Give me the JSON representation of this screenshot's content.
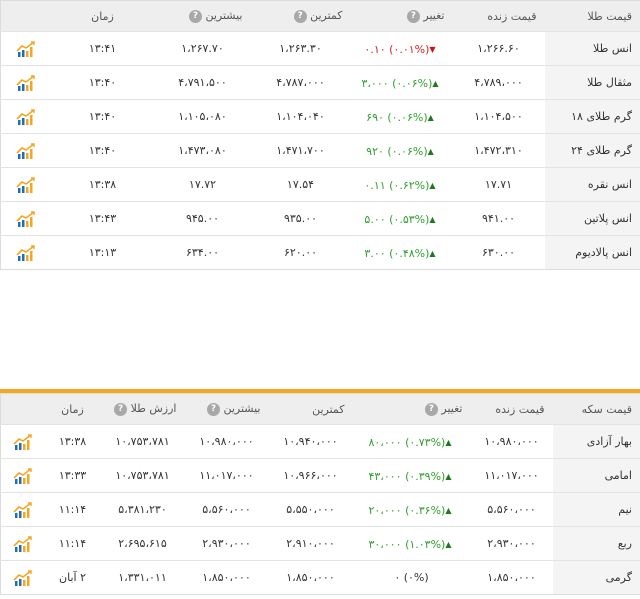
{
  "gold": {
    "headers": {
      "name": "قیمت طلا",
      "live": "قیمت زنده",
      "change": "تغییر",
      "low": "کمترین",
      "high": "بیشترین",
      "time": "زمان"
    },
    "rows": [
      {
        "name": "انس طلا",
        "live": "۱،۲۶۶.۶۰",
        "change_val": "۰.۱۰",
        "change_pct": "(۰.۰۱%)",
        "dir": "down",
        "low": "۱،۲۶۳.۳۰",
        "high": "۱،۲۶۷.۷۰",
        "time": "۱۳:۴۱"
      },
      {
        "name": "مثقال طلا",
        "live": "۴،۷۸۹،۰۰۰",
        "change_val": "۳،۰۰۰",
        "change_pct": "(۰.۰۶%)",
        "dir": "up",
        "low": "۴،۷۸۷،۰۰۰",
        "high": "۴،۷۹۱،۵۰۰",
        "time": "۱۳:۴۰"
      },
      {
        "name": "گرم طلای ۱۸",
        "live": "۱،۱۰۴،۵۰۰",
        "change_val": "۶۹۰",
        "change_pct": "(۰.۰۶%)",
        "dir": "up",
        "low": "۱،۱۰۴،۰۴۰",
        "high": "۱،۱۰۵،۰۸۰",
        "time": "۱۳:۴۰"
      },
      {
        "name": "گرم طلای ۲۴",
        "live": "۱،۴۷۲،۳۱۰",
        "change_val": "۹۲۰",
        "change_pct": "(۰.۰۶%)",
        "dir": "up",
        "low": "۱،۴۷۱،۷۰۰",
        "high": "۱،۴۷۳،۰۸۰",
        "time": "۱۳:۴۰"
      },
      {
        "name": "انس نقره",
        "live": "۱۷.۷۱",
        "change_val": "۰.۱۱",
        "change_pct": "(۰.۶۲%)",
        "dir": "up",
        "low": "۱۷.۵۴",
        "high": "۱۷.۷۲",
        "time": "۱۳:۳۸"
      },
      {
        "name": "انس پلاتین",
        "live": "۹۴۱.۰۰",
        "change_val": "۵.۰۰",
        "change_pct": "(۰.۵۳%)",
        "dir": "up",
        "low": "۹۳۵.۰۰",
        "high": "۹۴۵.۰۰",
        "time": "۱۳:۴۳"
      },
      {
        "name": "انس پالادیوم",
        "live": "۶۳۰.۰۰",
        "change_val": "۳.۰۰",
        "change_pct": "(۰.۴۸%)",
        "dir": "up",
        "low": "۶۲۰.۰۰",
        "high": "۶۳۴.۰۰",
        "time": "۱۳:۱۳"
      }
    ]
  },
  "coin": {
    "headers": {
      "name": "قیمت سکه",
      "live": "قیمت زنده",
      "change": "تغییر",
      "low": "کمترین",
      "high": "بیشترین",
      "gold_value": "ارزش طلا",
      "time": "زمان"
    },
    "rows": [
      {
        "name": "بهار آزادی",
        "live": "۱۰،۹۸۰،۰۰۰",
        "change_val": "۸۰،۰۰۰",
        "change_pct": "(۰.۷۳%)",
        "dir": "up",
        "low": "۱۰،۹۴۰،۰۰۰",
        "high": "۱۰،۹۸۰،۰۰۰",
        "gold_value": "۱۰،۷۵۳،۷۸۱",
        "time": "۱۳:۳۸"
      },
      {
        "name": "امامی",
        "live": "۱۱،۰۱۷،۰۰۰",
        "change_val": "۴۳،۰۰۰",
        "change_pct": "(۰.۳۹%)",
        "dir": "up",
        "low": "۱۰،۹۶۶،۰۰۰",
        "high": "۱۱،۰۱۷،۰۰۰",
        "gold_value": "۱۰،۷۵۳،۷۸۱",
        "time": "۱۳:۳۳"
      },
      {
        "name": "نیم",
        "live": "۵،۵۶۰،۰۰۰",
        "change_val": "۲۰،۰۰۰",
        "change_pct": "(۰.۳۶%)",
        "dir": "up",
        "low": "۵،۵۵۰،۰۰۰",
        "high": "۵،۵۶۰،۰۰۰",
        "gold_value": "۵،۳۸۱،۲۳۰",
        "time": "۱۱:۱۴"
      },
      {
        "name": "ربع",
        "live": "۲،۹۳۰،۰۰۰",
        "change_val": "۳۰،۰۰۰",
        "change_pct": "(۱.۰۳%)",
        "dir": "up",
        "low": "۲،۹۱۰،۰۰۰",
        "high": "۲،۹۳۰،۰۰۰",
        "gold_value": "۲،۶۹۵،۶۱۵",
        "time": "۱۱:۱۴"
      },
      {
        "name": "گرمی",
        "live": "۱،۸۵۰،۰۰۰",
        "change_val": "۰",
        "change_pct": "(۰%)",
        "dir": "none",
        "low": "۱،۸۵۰،۰۰۰",
        "high": "۱،۸۵۰،۰۰۰",
        "gold_value": "۱،۳۳۱،۰۱۱",
        "time": "۲ آبان"
      }
    ]
  },
  "icons": {
    "help": "?",
    "chart": "chart-icon"
  },
  "colors": {
    "up": "#2ea02e",
    "down": "#d92020",
    "accent": "#f5a623"
  }
}
